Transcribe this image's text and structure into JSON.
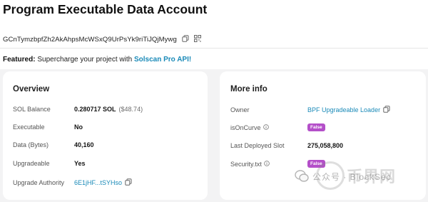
{
  "header": {
    "title": "Program Executable Data Account",
    "address": "GCnTymzbpfZh2AkAhpsMcWSxQ9UrPsYk9riTiJQjMywg"
  },
  "featured": {
    "prefix": "Featured:",
    "text": "Supercharge your project with",
    "link": "Solscan Pro API!"
  },
  "overview": {
    "title": "Overview",
    "rows": [
      {
        "label": "SOL Balance",
        "value": "0.280717 SOL",
        "extra": "($48.74)"
      },
      {
        "label": "Executable",
        "value": "No"
      },
      {
        "label": "Data (Bytes)",
        "value": "40,160"
      },
      {
        "label": "Upgradeable",
        "value": "Yes"
      },
      {
        "label": "Upgrade Authority",
        "value": "6E1jHF...tSYHso"
      }
    ]
  },
  "more_info": {
    "title": "More info",
    "rows": [
      {
        "label": "Owner",
        "value": "BPF Upgradeable Loader"
      },
      {
        "label": "isOnCurve",
        "value": "False"
      },
      {
        "label": "Last Deployed Slot",
        "value": "275,058,800"
      },
      {
        "label": "Security.txt",
        "value": "False"
      }
    ]
  },
  "watermark": {
    "text": "公众号 · BlockSec",
    "big_text": "币界网"
  },
  "colors": {
    "link": "#1a8ab8",
    "badge": "#b44fc9",
    "background": "#f3f3f4"
  }
}
